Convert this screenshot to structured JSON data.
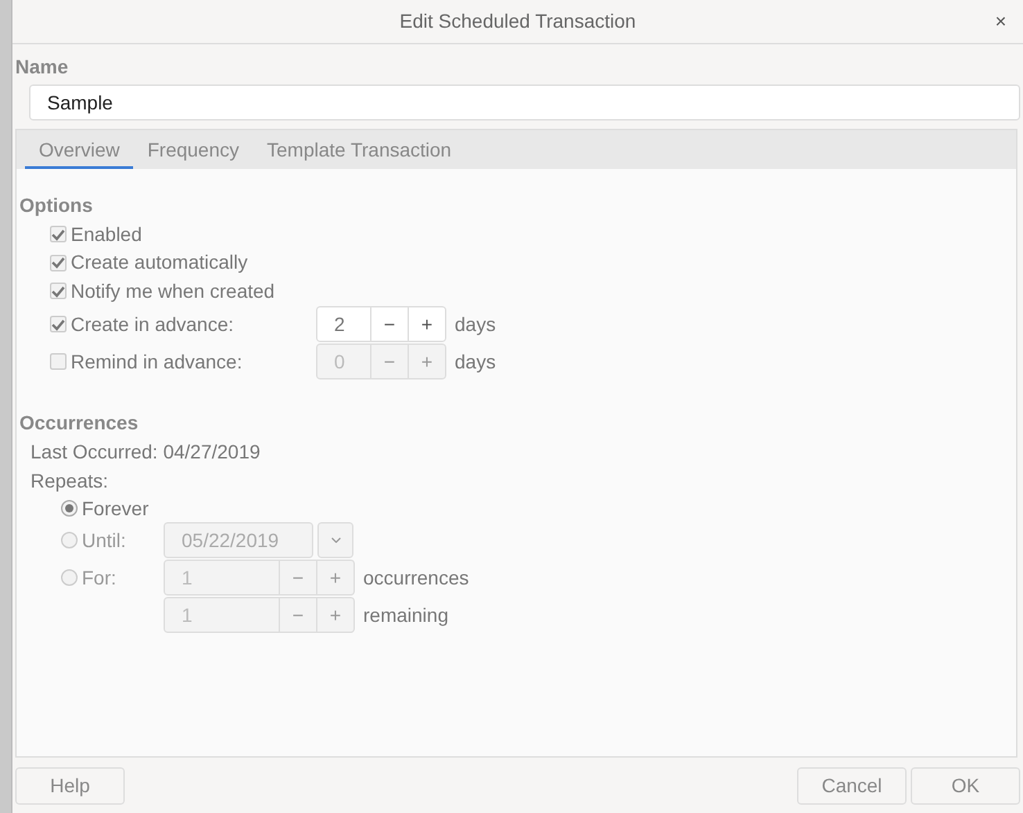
{
  "window": {
    "title": "Edit Scheduled Transaction",
    "close": "×"
  },
  "name": {
    "label": "Name",
    "value": "Sample"
  },
  "tabs": [
    {
      "label": "Overview",
      "selected": true
    },
    {
      "label": "Frequency",
      "selected": false
    },
    {
      "label": "Template Transaction",
      "selected": false
    }
  ],
  "options": {
    "heading": "Options",
    "items": [
      {
        "kind": "check",
        "label": "Enabled",
        "checked": true
      },
      {
        "kind": "check",
        "label": "Create automatically",
        "checked": true
      },
      {
        "kind": "check",
        "label": "Notify me when created",
        "checked": true
      },
      {
        "kind": "spin",
        "label": "Create in advance:",
        "checked": true,
        "value": "2",
        "minus": "−",
        "plus": "+",
        "unit": "days",
        "disabled": false
      },
      {
        "kind": "spin",
        "label": "Remind in advance:",
        "checked": false,
        "value": "0",
        "minus": "−",
        "plus": "+",
        "unit": "days",
        "disabled": true
      }
    ]
  },
  "occurrences": {
    "heading": "Occurrences",
    "last_occurred": "Last Occurred: 04/27/2019",
    "repeats_label": "Repeats:",
    "choices": [
      {
        "kind": "plain",
        "label": "Forever",
        "selected": true
      },
      {
        "kind": "date",
        "label": "Until:",
        "selected": false,
        "value": "05/22/2019"
      },
      {
        "kind": "spin",
        "label": "For:",
        "selected": false,
        "spinners": [
          {
            "value": "1",
            "minus": "−",
            "plus": "+",
            "unit": "occurrences"
          },
          {
            "value": "1",
            "minus": "−",
            "plus": "+",
            "unit": "remaining"
          }
        ]
      }
    ]
  },
  "footer": {
    "left": [
      {
        "label": "Help"
      }
    ],
    "right": [
      {
        "label": "Cancel"
      },
      {
        "label": "OK"
      }
    ]
  }
}
